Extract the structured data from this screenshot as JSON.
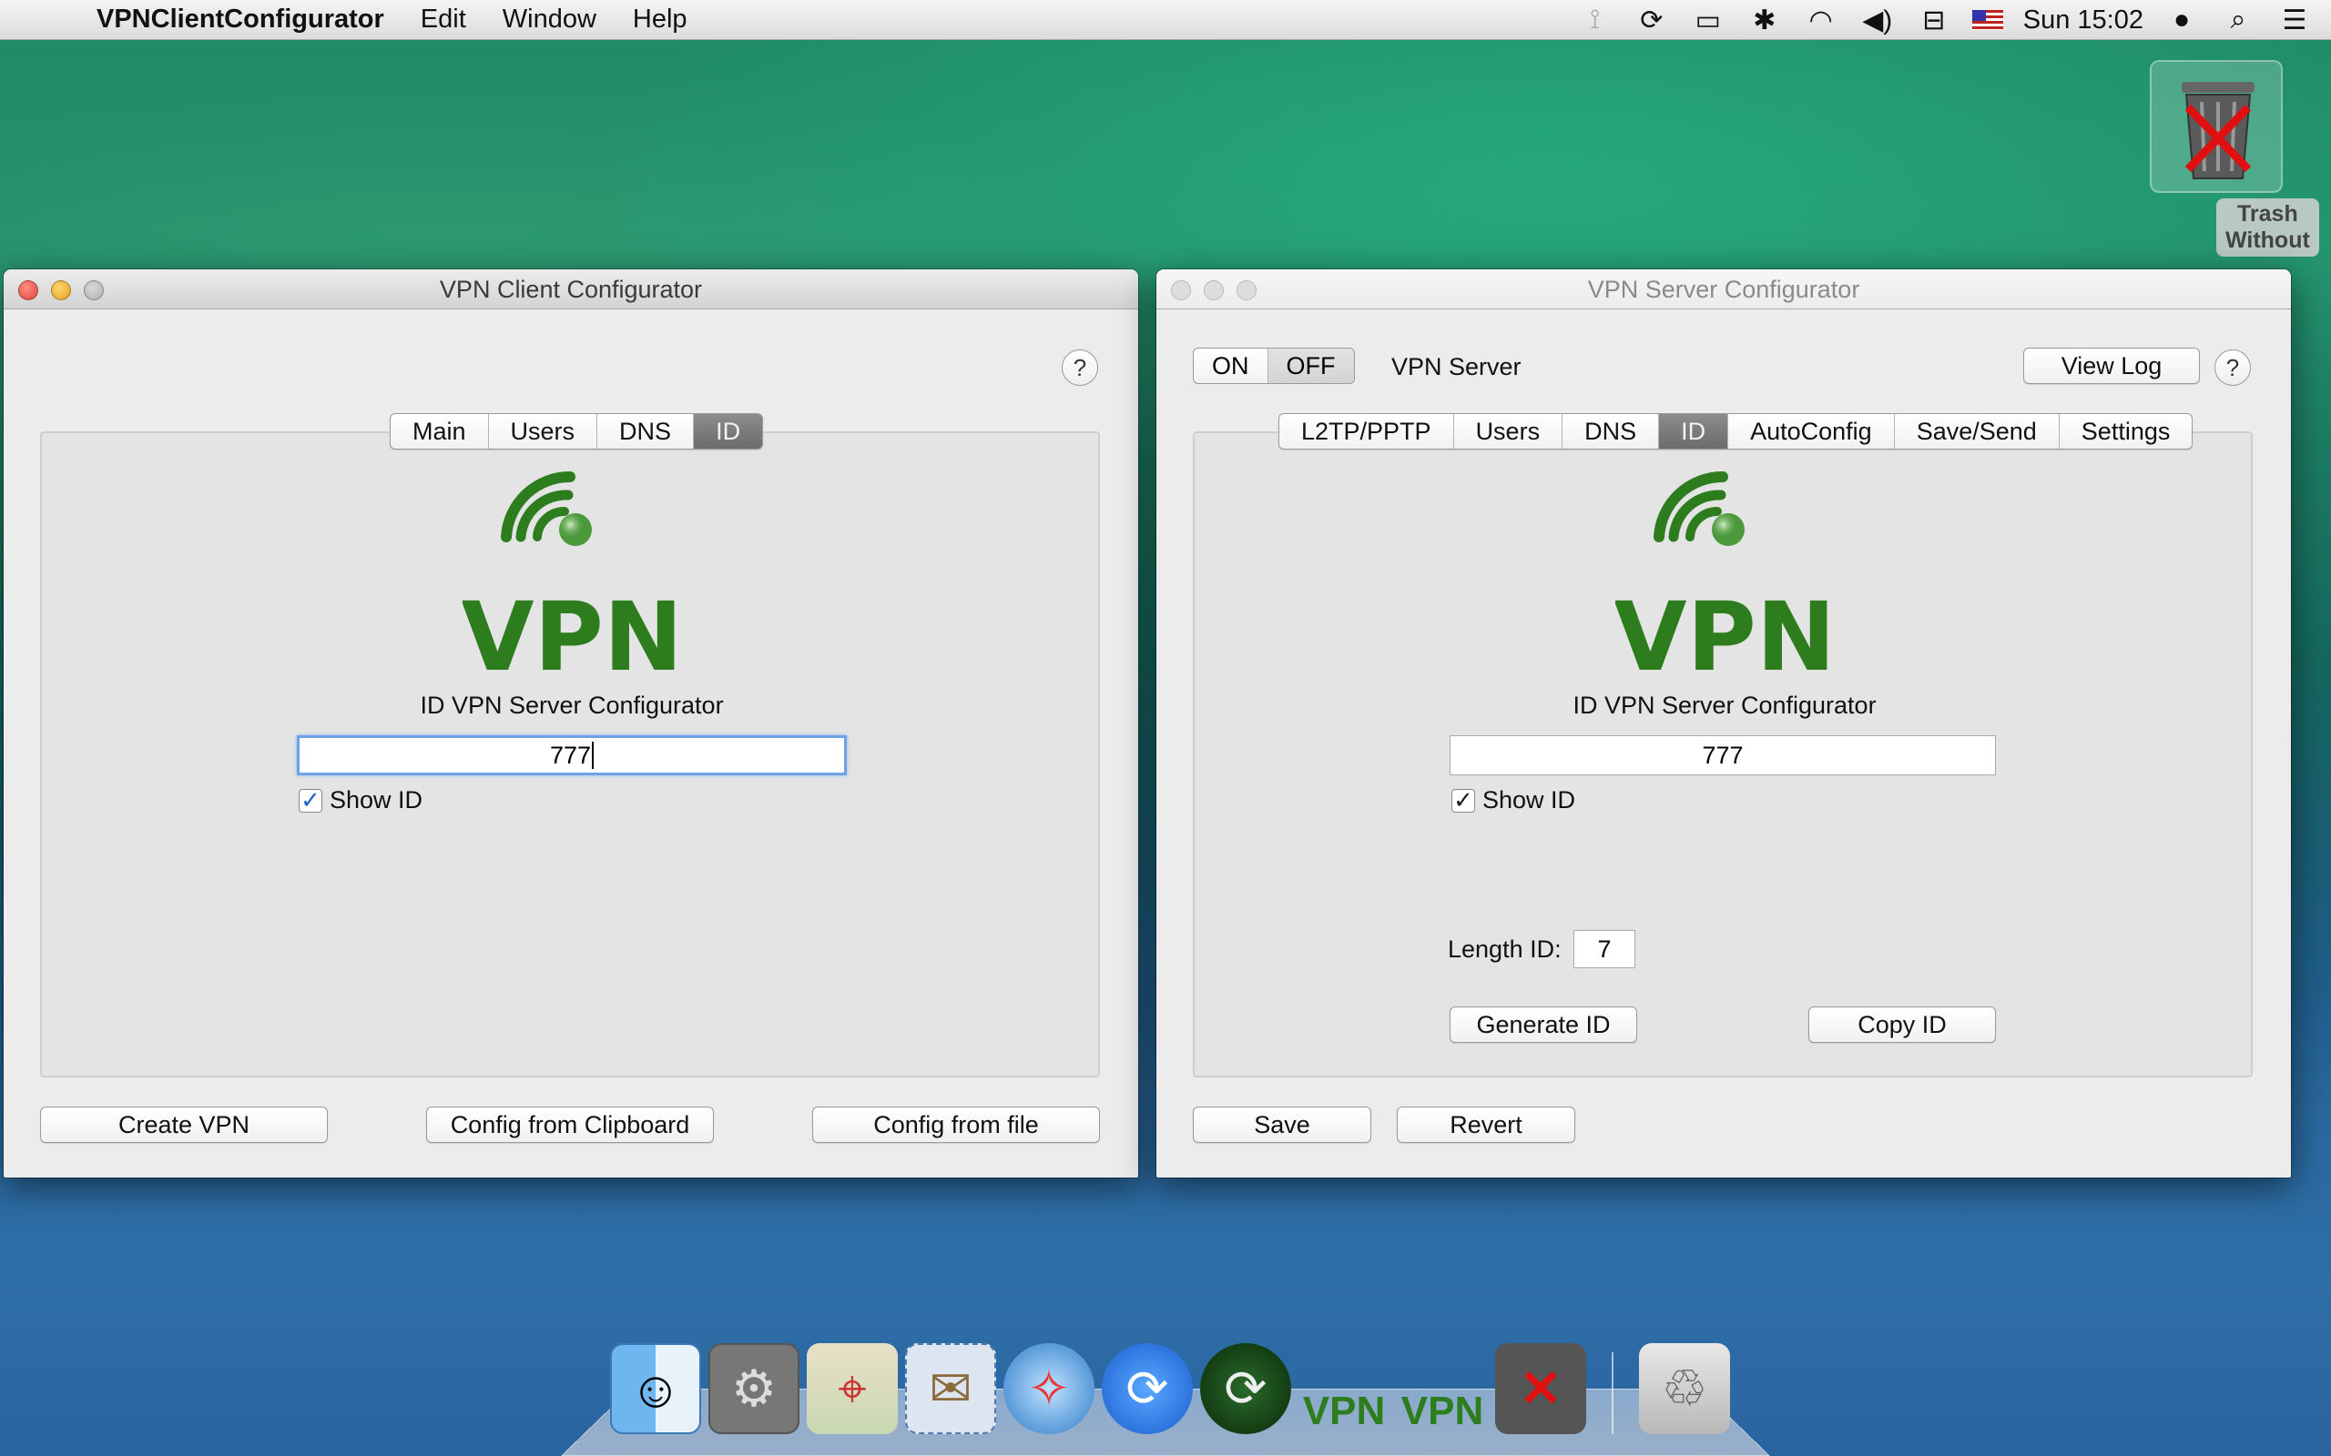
{
  "menubar": {
    "app_name": "VPNClientConfigurator",
    "menus": [
      "Edit",
      "Window",
      "Help"
    ],
    "clock": "Sun 15:02"
  },
  "desktop": {
    "trash_label": "Trash Without"
  },
  "client_window": {
    "title": "VPN Client Configurator",
    "help": "?",
    "tabs": [
      "Main",
      "Users",
      "DNS",
      "ID"
    ],
    "selected_tab": "ID",
    "logo_text": "VPN",
    "id_caption": "ID VPN Server Configurator",
    "id_value": "777",
    "show_id_label": "Show ID",
    "show_id_checked": true,
    "buttons": {
      "create": "Create VPN",
      "clipboard": "Config from Clipboard",
      "file": "Config from file"
    }
  },
  "server_window": {
    "title": "VPN Server Configurator",
    "toggle_on": "ON",
    "toggle_off": "OFF",
    "server_label": "VPN Server",
    "view_log": "View Log",
    "help": "?",
    "tabs": [
      "L2TP/PPTP",
      "Users",
      "DNS",
      "ID",
      "AutoConfig",
      "Save/Send",
      "Settings"
    ],
    "selected_tab": "ID",
    "logo_text": "VPN",
    "id_caption": "ID VPN Server Configurator",
    "id_value": "777",
    "show_id_label": "Show ID",
    "show_id_checked": true,
    "length_label": "Length ID:",
    "length_value": "7",
    "buttons": {
      "generate": "Generate ID",
      "copy": "Copy ID",
      "save": "Save",
      "revert": "Revert"
    }
  },
  "dock": {
    "items": [
      "finder-icon",
      "system-preferences-icon",
      "maps-icon",
      "mail-icon",
      "safari-icon",
      "sync-icon",
      "sync-binary-icon",
      "vpn-server-icon",
      "vpn-client-icon",
      "trash-without-icon",
      "trash-icon"
    ]
  },
  "colors": {
    "vpn_green": "#2d7d1e",
    "selected_tab": "#777777",
    "focus_ring": "#6ea1e6"
  }
}
